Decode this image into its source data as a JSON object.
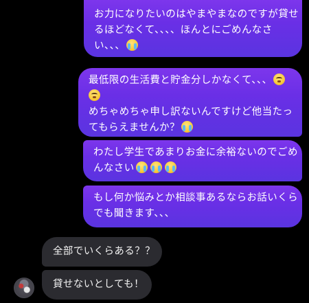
{
  "messages": [
    {
      "direction": "sent",
      "lines": [
        {
          "text": "お力になりたいのはやまやまなのですが貸せ",
          "emoji": null
        },
        {
          "text": "るほどなくて、、、、ほんとにごめんなさ",
          "emoji": null
        },
        {
          "text": "い、、、",
          "emoji": "loudly-crying-face-icon"
        }
      ]
    },
    {
      "direction": "sent",
      "lines": [
        {
          "text": "最低限の生活費と貯金分しかなくて、、、",
          "emoji": "face-holding-back-tears-icon"
        },
        {
          "text": "",
          "emoji": "face-holding-back-tears-icon"
        },
        {
          "text": "めちゃめちゃ申し訳ないんですけど他当たっ",
          "emoji": null
        },
        {
          "text": "てもらえませんか？",
          "emoji": "loudly-crying-face-icon"
        }
      ]
    },
    {
      "direction": "sent",
      "lines": [
        {
          "text": "わたし学生であまりお金に余裕ないのでごめ",
          "emoji": null
        },
        {
          "text": "んなさい",
          "emoji": "loudly-crying-face-icon-x3"
        }
      ]
    },
    {
      "direction": "sent",
      "lines": [
        {
          "text": "もし何か悩みとか相談事あるならお話いくら",
          "emoji": null
        },
        {
          "text": "でも聞きます、、、",
          "emoji": null
        }
      ]
    },
    {
      "direction": "received",
      "lines": [
        {
          "text": "全部でいくらある？？",
          "emoji": null
        }
      ]
    },
    {
      "direction": "received",
      "lines": [
        {
          "text": "貸せないとしても！",
          "emoji": null
        }
      ]
    }
  ],
  "colors": {
    "background": "#000000",
    "sent_bubble": "#6a2fe6",
    "received_bubble": "#2b2b30",
    "text": "#ffffff"
  }
}
